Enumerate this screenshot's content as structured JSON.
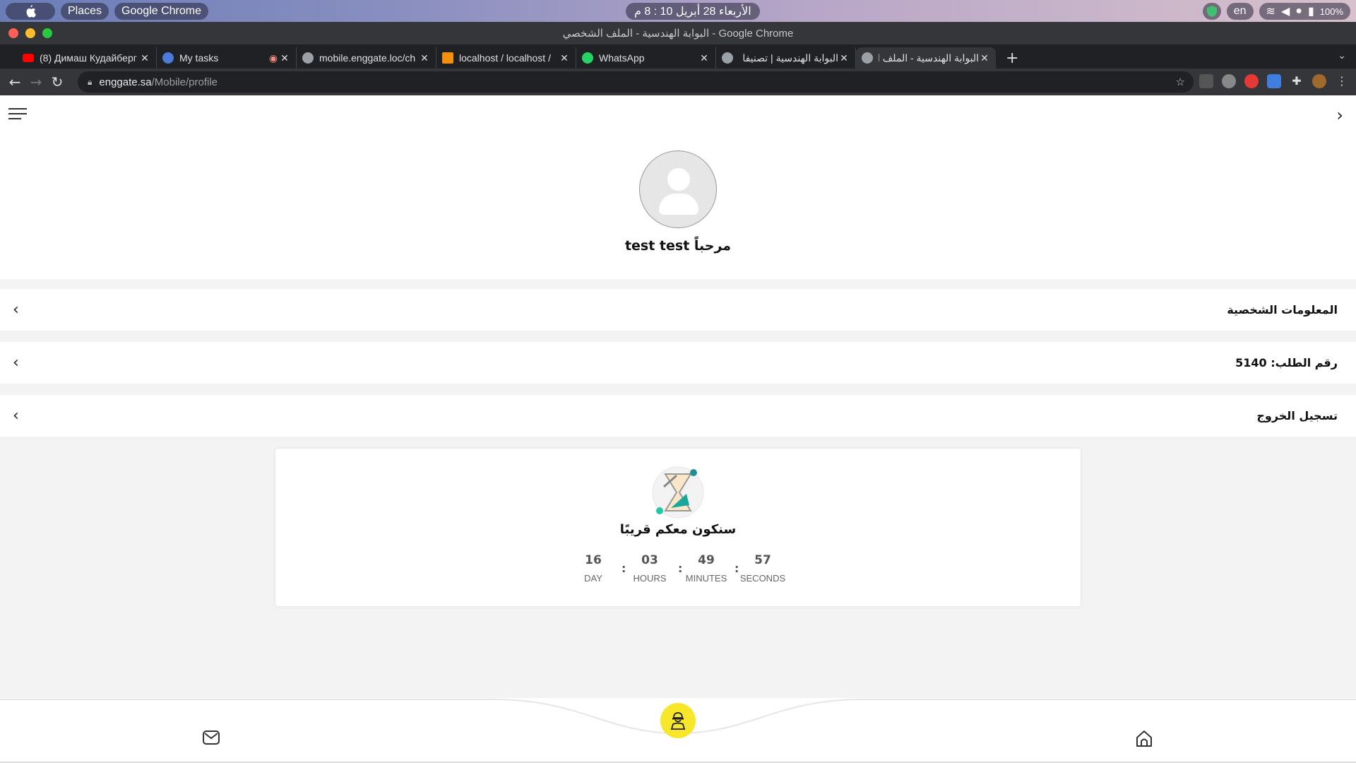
{
  "topbar": {
    "places": "Places",
    "app": "Google Chrome",
    "clock": "الأربعاء 28 أبريل  10 : 8 م",
    "lang": "en",
    "battery": "100%"
  },
  "window": {
    "title": "البوابة الهندسية - الملف الشخصي - Google Chrome"
  },
  "tabs": [
    {
      "label": "(8) Димаш Кудайберг",
      "favicon_color": "#ff0000"
    },
    {
      "label": "My tasks",
      "favicon_color": "#4a7bd8"
    },
    {
      "label": "mobile.enggate.loc/ch",
      "favicon_color": "#9aa0a6"
    },
    {
      "label": "localhost / localhost / ",
      "favicon_color": "#f29111"
    },
    {
      "label": "WhatsApp",
      "favicon_color": "#25d366"
    },
    {
      "label": "البوابة الهندسية | تصنيفا",
      "favicon_color": "#9aa0a6"
    },
    {
      "label": "البوابة الهندسية - الملف ال",
      "favicon_color": "#9aa0a6"
    }
  ],
  "address": {
    "domain": "enggate.sa",
    "path": "/Mobile/profile"
  },
  "profile": {
    "greeting": "مرحباً test test"
  },
  "menu": {
    "personal_info": "المعلومات الشخصية",
    "order_number": "رقم الطلب: 5140",
    "logout": "تسجيل الخروج"
  },
  "coming_soon": {
    "title": "سنكون معكم قريبًا",
    "day": {
      "value": "16",
      "label": "DAY"
    },
    "hours": {
      "value": "03",
      "label": "HOURS"
    },
    "minutes": {
      "value": "49",
      "label": "MINUTES"
    },
    "seconds": {
      "value": "57",
      "label": "SECONDS"
    }
  },
  "colors": {
    "accent_yellow": "#f6e72a",
    "teal": "#1aa79c"
  },
  "icons": {
    "mail": "mail-icon",
    "home": "home-icon",
    "engineer": "engineer-icon"
  }
}
